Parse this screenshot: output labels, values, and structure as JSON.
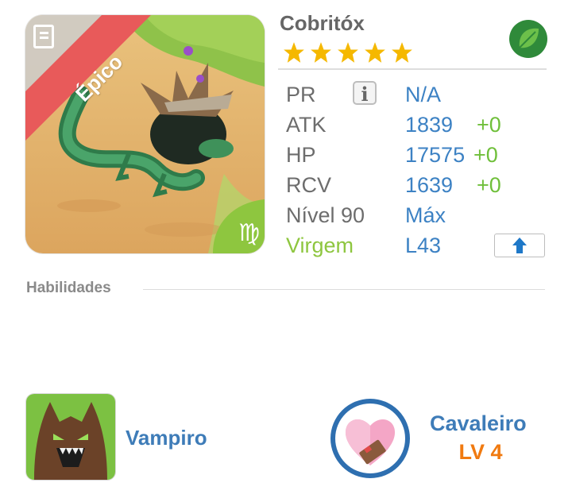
{
  "monster": {
    "name": "Cobritóx",
    "rarity": "Épico",
    "stars": 5,
    "element_icon": "leaf-icon",
    "zodiac_icon": "virgo-icon",
    "zodiac_symbol": "♍"
  },
  "stats": {
    "pr": {
      "label": "PR",
      "value": "N/A"
    },
    "atk": {
      "label": "ATK",
      "value": "1839",
      "bonus": "+0"
    },
    "hp": {
      "label": "HP",
      "value": "17575",
      "bonus": "+0"
    },
    "rcv": {
      "label": "RCV",
      "value": "1639",
      "bonus": "+0"
    },
    "level": {
      "label": "Nível 90",
      "value": "Máx"
    },
    "sign": {
      "label": "Virgem",
      "value": "L43"
    }
  },
  "skills": {
    "title": "Habilidades",
    "active": {
      "name": "Vampiro",
      "icon": "werewolf-icon"
    },
    "passive": {
      "name": "Cavaleiro",
      "level": "LV 4",
      "icon": "heart-shield-icon"
    }
  },
  "colors": {
    "label_gray": "#6d6d6d",
    "value_blue": "#3d82c4",
    "bonus_green": "#6fbf3a",
    "zodiac_green": "#8ec63f",
    "level_orange": "#f07a10",
    "rarity_red": "#e85a5a"
  }
}
